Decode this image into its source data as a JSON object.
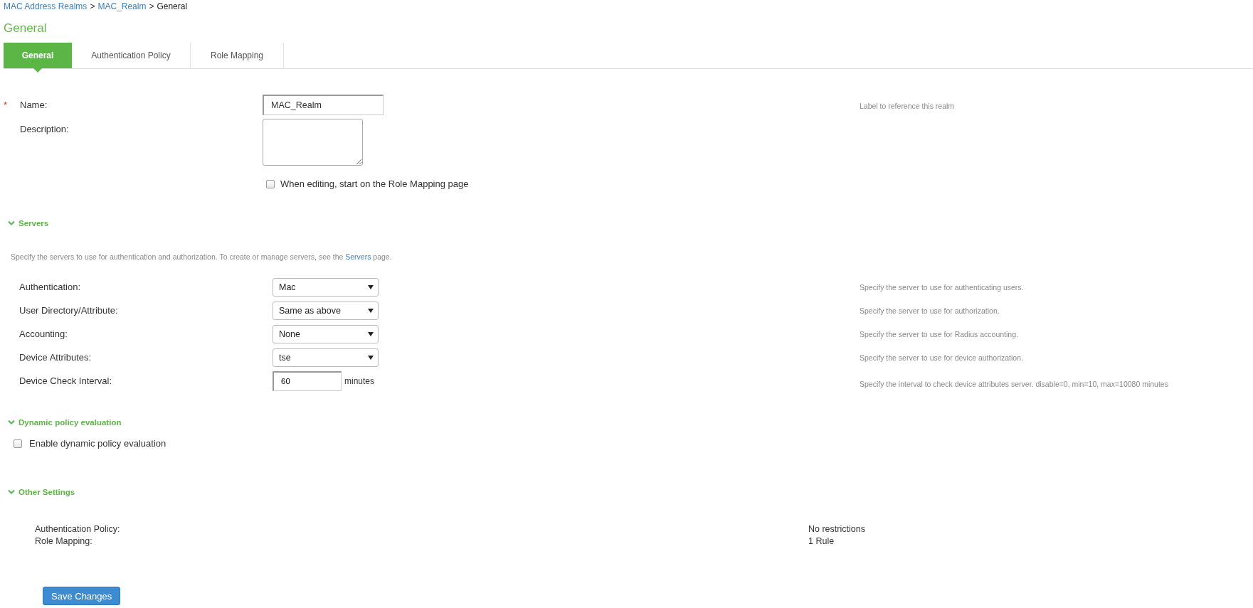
{
  "breadcrumb": [
    {
      "label": "MAC Address Realms",
      "kind": "link"
    },
    {
      "label": "MAC_Realm",
      "kind": "link"
    },
    {
      "label": "General",
      "kind": "current"
    }
  ],
  "breadcrumb_separator": ">",
  "page_title": "General",
  "tabs": [
    {
      "label": "General",
      "selected": true
    },
    {
      "label": "Authentication Policy",
      "selected": false
    },
    {
      "label": "Role Mapping",
      "selected": false
    }
  ],
  "general": {
    "fields": [
      {
        "label": "Name:",
        "required_mark": "*",
        "kind": "text",
        "value": "MAC_Realm",
        "help": "Label to reference this realm"
      },
      {
        "label": "Description:",
        "kind": "textarea"
      }
    ],
    "start_option": {
      "label": "When editing, start on the Role Mapping page",
      "checked": false
    }
  },
  "servers": {
    "title": "Servers",
    "expanded": true,
    "intro_before": "Specify the servers to use for authentication and authorization. To create or manage servers, see the",
    "intro_link": "Servers",
    "intro_after": "page.",
    "rows": [
      {
        "label": "Authentication:",
        "kind": "select",
        "value": "Mac",
        "help": "Specify the server to use for authenticating users."
      },
      {
        "label": "User Directory/Attribute:",
        "kind": "select",
        "value": "Same as above",
        "help": "Specify the server to use for authorization."
      },
      {
        "label": "Accounting:",
        "kind": "select",
        "value": "None",
        "help": "Specify the server to use for Radius accounting."
      },
      {
        "label": "Device Attributes:",
        "kind": "select",
        "value": "tse",
        "help": "Specify the server to use for device authorization."
      },
      {
        "label": "Device Check Interval:",
        "kind": "number",
        "value": "60",
        "unit": "minutes",
        "help": "Specify the interval to check device attributes server. disable=0, min=10, max=10080 minutes"
      }
    ]
  },
  "dynamic_policy": {
    "title": "Dynamic policy evaluation",
    "expanded": true,
    "option": {
      "label": "Enable dynamic policy evaluation",
      "checked": false
    }
  },
  "other_settings": {
    "title": "Other Settings",
    "expanded": true,
    "rows": [
      {
        "label": "Authentication Policy:",
        "value": "No restrictions"
      },
      {
        "label": "Role Mapping:",
        "value": "1 Rule"
      }
    ]
  },
  "save_button": "Save Changes"
}
